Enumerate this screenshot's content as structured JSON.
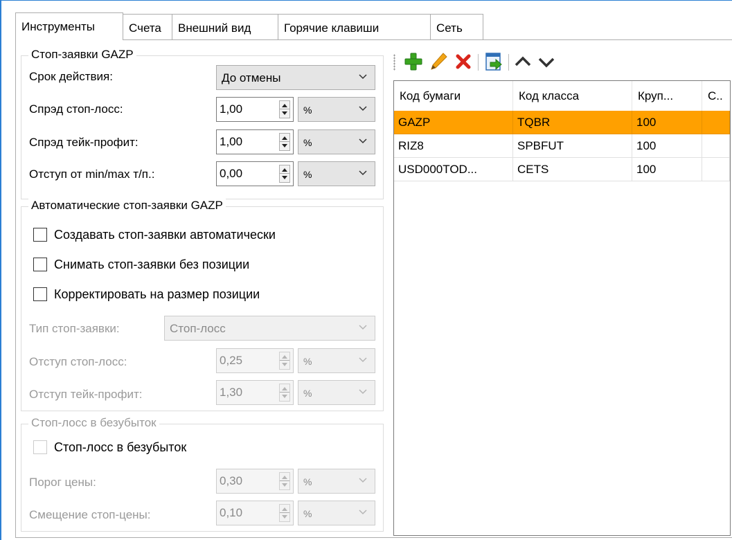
{
  "tabs": [
    {
      "label": "Инструменты",
      "active": true
    },
    {
      "label": "Счета"
    },
    {
      "label": "Внешний вид"
    },
    {
      "label": "Горячие клавиши"
    },
    {
      "label": "Сеть"
    }
  ],
  "stop_orders": {
    "legend": "Стоп-заявки GAZP",
    "validity_label": "Срок действия:",
    "validity_value": "До отмены",
    "sl_spread_label": "Спрэд стоп-лосс:",
    "sl_spread_value": "1,00",
    "sl_spread_unit": "%",
    "tp_spread_label": "Спрэд тейк-профит:",
    "tp_spread_value": "1,00",
    "tp_spread_unit": "%",
    "minmax_label": "Отступ от min/max т/п.:",
    "minmax_value": "0,00",
    "minmax_unit": "%"
  },
  "auto_stop_orders": {
    "legend": "Автоматические стоп-заявки GAZP",
    "create_auto": "Создавать стоп-заявки автоматически",
    "remove_no_position": "Снимать стоп-заявки без позиции",
    "adjust_to_position": "Корректировать на размер позиции",
    "type_label": "Тип стоп-заявки:",
    "type_value": "Стоп-лосс",
    "sl_offset_label": "Отступ стоп-лосс:",
    "sl_offset_value": "0,25",
    "sl_offset_unit": "%",
    "tp_offset_label": "Отступ тейк-профит:",
    "tp_offset_value": "1,30",
    "tp_offset_unit": "%"
  },
  "breakeven": {
    "legend": "Стоп-лосс в безубыток",
    "check_label": "Стоп-лосс в безубыток",
    "price_threshold_label": "Порог цены:",
    "price_threshold_value": "0,30",
    "price_threshold_unit": "%",
    "stop_shift_label": "Смещение стоп-цены:",
    "stop_shift_value": "0,10",
    "stop_shift_unit": "%"
  },
  "toolbar": {
    "icons": [
      "add-icon",
      "edit-icon",
      "delete-icon",
      "import-icon",
      "chevron-up-icon",
      "chevron-down-icon"
    ],
    "colors": {
      "add": "#3aa51f",
      "edit": "#f2a516",
      "delete": "#d9261c",
      "selected_row": "#ffa000"
    }
  },
  "grid": {
    "columns": [
      "Код бумаги",
      "Код класса",
      "Круп...",
      "С.."
    ],
    "rows": [
      {
        "code": "GAZP",
        "class": "TQBR",
        "lot": "100",
        "c": "",
        "selected": true
      },
      {
        "code": "RIZ8",
        "class": "SPBFUT",
        "lot": "100",
        "c": ""
      },
      {
        "code": "USD000TOD...",
        "class": "CETS",
        "lot": "100",
        "c": ""
      }
    ]
  }
}
